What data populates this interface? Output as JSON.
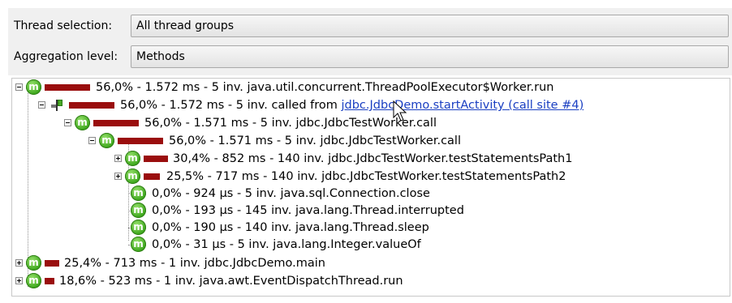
{
  "controls": {
    "thread_selection_label": "Thread selection:",
    "thread_selection_value": "All thread groups",
    "aggregation_label": "Aggregation level:",
    "aggregation_value": "Methods"
  },
  "tree": {
    "n1": "56,0% - 1.572 ms - 5 inv. java.util.concurrent.ThreadPoolExecutor$Worker.run",
    "n2_prefix": "56,0% - 1.572 ms - 5 inv. called from ",
    "n2_link": "jdbc.JdbcDemo.startActivity (call site #4)",
    "n3": "56,0% - 1.571 ms - 5 inv. jdbc.JdbcTestWorker.call",
    "n4": "56,0% - 1.571 ms - 5 inv. jdbc.JdbcTestWorker.call",
    "n5": "30,4% - 852 ms - 140 inv. jdbc.JdbcTestWorker.testStatementsPath1",
    "n6": "25,5% - 717 ms - 140 inv. jdbc.JdbcTestWorker.testStatementsPath2",
    "n7": "0,0% - 924 µs - 5 inv. java.sql.Connection.close",
    "n8": "0,0% - 193 µs - 145 inv. java.lang.Thread.interrupted",
    "n9": "0,0% - 190 µs - 140 inv. java.lang.Thread.sleep",
    "n10": "0,0% - 31 µs - 5 inv. java.lang.Integer.valueOf",
    "n11": "25,4% - 713 ms - 1 inv. jdbc.JdbcDemo.main",
    "n12": "18,6% - 523 ms - 1 inv. java.awt.EventDispatchThread.run",
    "method_icon_letter": "m"
  },
  "colors": {
    "bar": "#9a0e0e",
    "method_icon": "#3aa51a",
    "link": "#1a3fc2"
  },
  "icons": [
    "method-icon",
    "call-site-flag-icon",
    "expand-icon",
    "collapse-icon"
  ]
}
